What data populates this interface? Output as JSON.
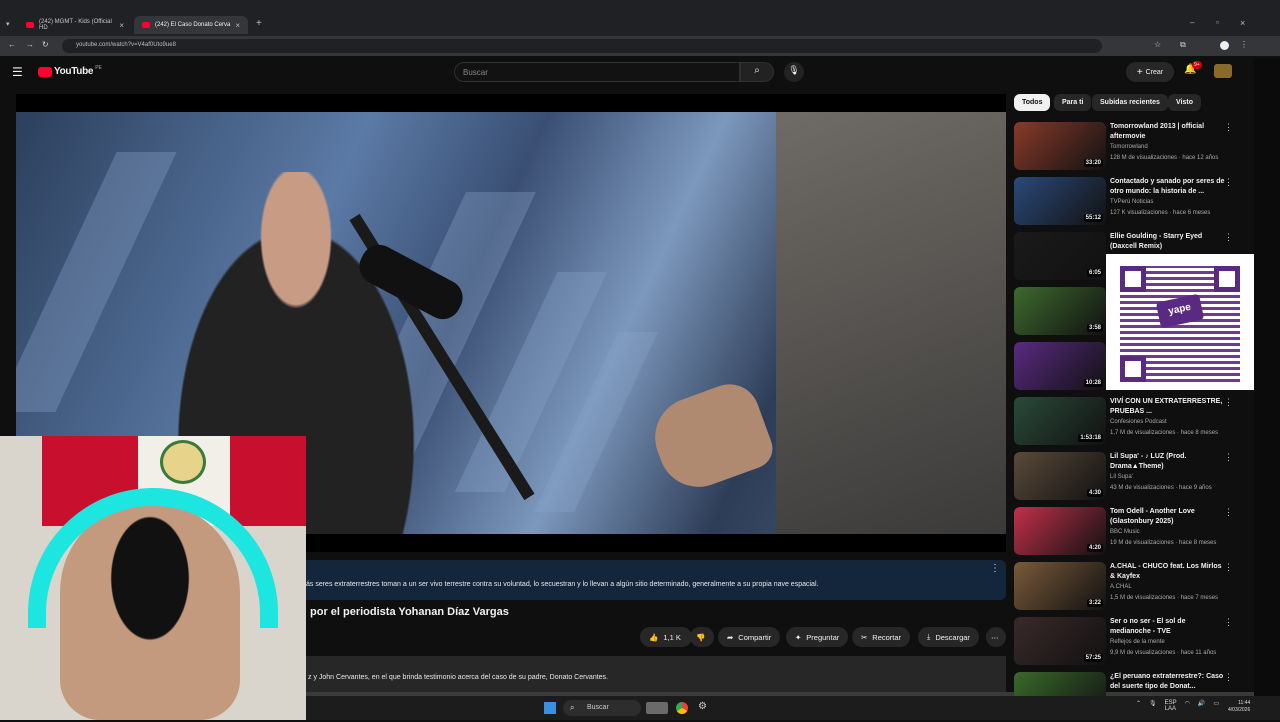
{
  "browser": {
    "tabs": [
      {
        "label": "(242) MGMT - Kids (Official HD"
      },
      {
        "label": "(242) El Caso Donato Cerva"
      }
    ],
    "url": "youtube.com/watch?v=V4af0Uto9ue8"
  },
  "youtube": {
    "logo": "YouTube",
    "region": "PE",
    "search_placeholder": "Buscar",
    "create_label": "Crear",
    "notifications_badge": "9+"
  },
  "chips": [
    "Todos",
    "Para ti",
    "Subidas recientes",
    "Visto"
  ],
  "video": {
    "description_line": "ás seres extraterrestres toman a un ser vivo terrestre contra su voluntad, lo secuestran y lo llevan a algún sitio determinado, generalmente a su propia nave espacial.",
    "title": "por el periodista Yohanan Díaz Vargas",
    "likes": "1,1 K",
    "actions": {
      "share": "Compartir",
      "ask": "Preguntar",
      "clip": "Recortar",
      "download": "Descargar"
    },
    "description_2": "z y John Cervantes, en el que brinda testimonio acerca del caso de su padre, Donato Cervantes."
  },
  "recommendations": [
    {
      "title": "Tomorrowland 2013 | official aftermovie",
      "channel": "Tomorrowland",
      "meta": "128 M de visualizaciones · hace 12 años",
      "duration": "33:20",
      "color": "#8a3a2a"
    },
    {
      "title": "Contactado y sanado por seres de otro mundo: la historia de ...",
      "channel": "TVPerú Noticias",
      "meta": "127 K visualizaciones · hace 6 meses",
      "duration": "55:12",
      "color": "#2b4a7a"
    },
    {
      "title": "Ellie Goulding - Starry Eyed (Daxcell Remix)",
      "channel": "",
      "meta": "",
      "duration": "6:05",
      "color": "#1a1a1a"
    },
    {
      "title": "",
      "channel": "",
      "meta": "",
      "duration": "3:58",
      "color": "#3d6a2e"
    },
    {
      "title": "",
      "channel": "",
      "meta": "",
      "duration": "10:28",
      "color": "#5a2a82"
    },
    {
      "title": "VIVÍ CON UN EXTRATERRESTRE, PRUEBAS ...",
      "channel": "Confesiones Podcast",
      "meta": "1,7 M de visualizaciones · hace 8 meses",
      "duration": "1:53:18",
      "color": "#2a4a3a"
    },
    {
      "title": "Lil Supa' - ♪ LUZ (Prod. Drama▲Theme)",
      "channel": "Lil Supa'",
      "meta": "43 M de visualizaciones · hace 9 años",
      "duration": "4:30",
      "color": "#5a4a3a"
    },
    {
      "title": "Tom Odell - Another Love (Glastonbury 2025)",
      "channel": "BBC Music",
      "meta": "19 M de visualizaciones · hace 8 meses",
      "duration": "4:20",
      "color": "#c2304a"
    },
    {
      "title": "A.CHAL - CHUCO feat. Los Mirlos & Kayfex",
      "channel": "A.CHAL",
      "meta": "1,5 M de visualizaciones · hace 7 meses",
      "duration": "3:22",
      "color": "#7a5a3a"
    },
    {
      "title": "Ser o no ser - El sol de medianoche - TVE",
      "channel": "Reflejos de la mente",
      "meta": "9,9 M de visualizaciones · hace 11 años",
      "duration": "57:25",
      "color": "#3a2a2a"
    },
    {
      "title": "¿El peruano extraterrestre?: Caso del suerte tipo de Donat...",
      "channel": "",
      "meta": "",
      "duration": "",
      "color": "#3a6a2a"
    }
  ],
  "donation": {
    "brand": "yape"
  },
  "taskbar": {
    "search": "Buscar",
    "lang": "ESP\nLAA",
    "time": "11:44",
    "date": "4/03/2026"
  }
}
